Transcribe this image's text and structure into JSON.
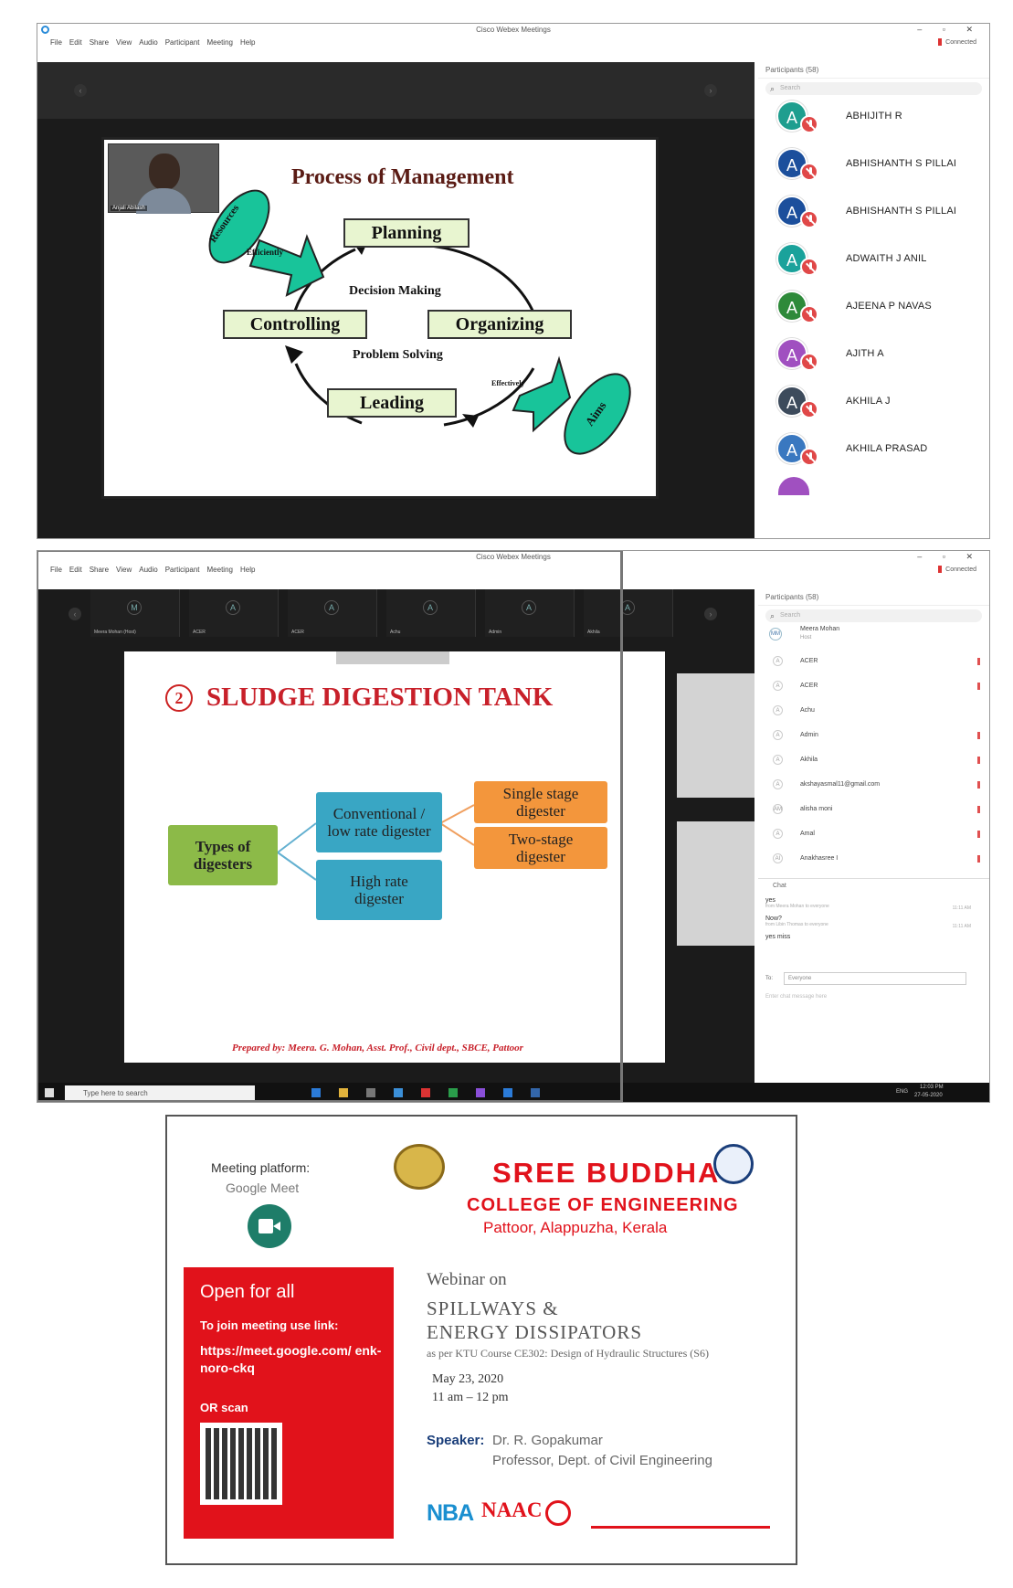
{
  "screenshot1": {
    "window_title": "Cisco Webex Meetings",
    "menu": [
      "File",
      "Edit",
      "Share",
      "View",
      "Audio",
      "Participant",
      "Meeting",
      "Help"
    ],
    "status": "Connected",
    "video_label": "Anjali Abilash",
    "slide": {
      "title": "Process of Management",
      "boxes": {
        "planning": "Planning",
        "organizing": "Organizing",
        "leading": "Leading",
        "controlling": "Controlling"
      },
      "center_top": "Decision Making",
      "center_bottom": "Problem Solving",
      "resources": "Resources",
      "efficiently": "Efficiently",
      "effectively": "Effectively",
      "aims": "Aims"
    },
    "participants_header": "Participants (58)",
    "search_placeholder": "Search",
    "participants": [
      {
        "initial": "A",
        "name": "ABHIJITH R",
        "color": "#1f9e8f"
      },
      {
        "initial": "A",
        "name": "ABHISHANTH S PILLAI",
        "color": "#1c4f9c"
      },
      {
        "initial": "A",
        "name": "ABHISHANTH S PILLAI",
        "color": "#1c4f9c"
      },
      {
        "initial": "A",
        "name": "ADWAITH J ANIL",
        "color": "#1aa29b"
      },
      {
        "initial": "A",
        "name": "AJEENA P NAVAS",
        "color": "#2e8a3a"
      },
      {
        "initial": "A",
        "name": "AJITH A",
        "color": "#a050c0"
      },
      {
        "initial": "A",
        "name": "AKHILA J",
        "color": "#3d4b5c"
      },
      {
        "initial": "A",
        "name": "AKHILA PRASAD",
        "color": "#3a78c0"
      }
    ]
  },
  "screenshot2": {
    "window_title": "Cisco Webex Meetings",
    "menu": [
      "File",
      "Edit",
      "Share",
      "View",
      "Audio",
      "Participant",
      "Meeting",
      "Help"
    ],
    "status": "Connected",
    "thumbs": [
      {
        "initial": "M",
        "label": "Meera Mohan (Host)"
      },
      {
        "initial": "A",
        "label": "ACER"
      },
      {
        "initial": "A",
        "label": "ACER"
      },
      {
        "initial": "A",
        "label": "Achu"
      },
      {
        "initial": "A",
        "label": "Admin"
      },
      {
        "initial": "A",
        "label": "Akhila"
      }
    ],
    "slide": {
      "number": "2",
      "title": "SLUDGE DIGESTION TANK",
      "types": "Types of digesters",
      "conventional": "Conventional / low rate digester",
      "high_rate": "High rate digester",
      "single": "Single stage digester",
      "two": "Two-stage digester",
      "footer": "Prepared by: Meera. G. Mohan, Asst. Prof., Civil dept., SBCE, Pattoor"
    },
    "participants_header": "Participants (58)",
    "search_placeholder": "Search",
    "host": {
      "initial": "MM",
      "name": "Meera Mohan",
      "role": "Host"
    },
    "participants": [
      {
        "initial": "A",
        "name": "ACER"
      },
      {
        "initial": "A",
        "name": "ACER"
      },
      {
        "initial": "A",
        "name": "Achu"
      },
      {
        "initial": "A",
        "name": "Admin"
      },
      {
        "initial": "A",
        "name": "Akhila"
      },
      {
        "initial": "A",
        "name": "akshayasmal11@gmail.com"
      },
      {
        "initial": "AM",
        "name": "alisha moni"
      },
      {
        "initial": "A",
        "name": "Amal"
      },
      {
        "initial": "AI",
        "name": "Anakhasree I"
      }
    ],
    "chat_header": "Chat",
    "chat": [
      {
        "text": "yes",
        "meta": "from Meera Mohan to everyone",
        "time": "11:11 AM"
      },
      {
        "text": "Now?",
        "meta": "from Libin Thomas to everyone",
        "time": "11:11 AM"
      },
      {
        "text": "yes miss",
        "meta": "",
        "time": ""
      }
    ],
    "to_label": "To:",
    "to_value": "Everyone",
    "chat_placeholder": "Enter chat message here",
    "taskbar_search": "Type here to search",
    "clock_time": "12:03 PM",
    "clock_date": "27-05-2020",
    "lang": "ENG"
  },
  "poster": {
    "platform_label": "Meeting platform:",
    "platform_name": "Google Meet",
    "college_name": "SREE BUDDHA",
    "college_sub": "COLLEGE OF ENGINEERING",
    "college_place": "Pattoor, Alappuzha, Kerala",
    "open_for_all": "Open for all",
    "join_label": "To join meeting use link:",
    "link": "https://meet.google.com/ enk-noro-ckq",
    "or_scan": "OR scan",
    "webinar_on": "Webinar on",
    "topic_line1": "SPILLWAYS &",
    "topic_line2": "ENERGY DISSIPATORS",
    "course": "as per KTU Course CE302: Design of Hydraulic Structures (S6)",
    "date": "May 23, 2020",
    "time": "11 am – 12 pm",
    "speaker_label": "Speaker:",
    "speaker_name": "Dr. R. Gopakumar",
    "speaker_title": "Professor, Dept. of Civil Engineering",
    "nba": "NBA",
    "naac": "NAAC",
    "colors": {
      "red": "#e1121b",
      "green": "#1e7d69",
      "navy": "#1a3e7a"
    }
  }
}
